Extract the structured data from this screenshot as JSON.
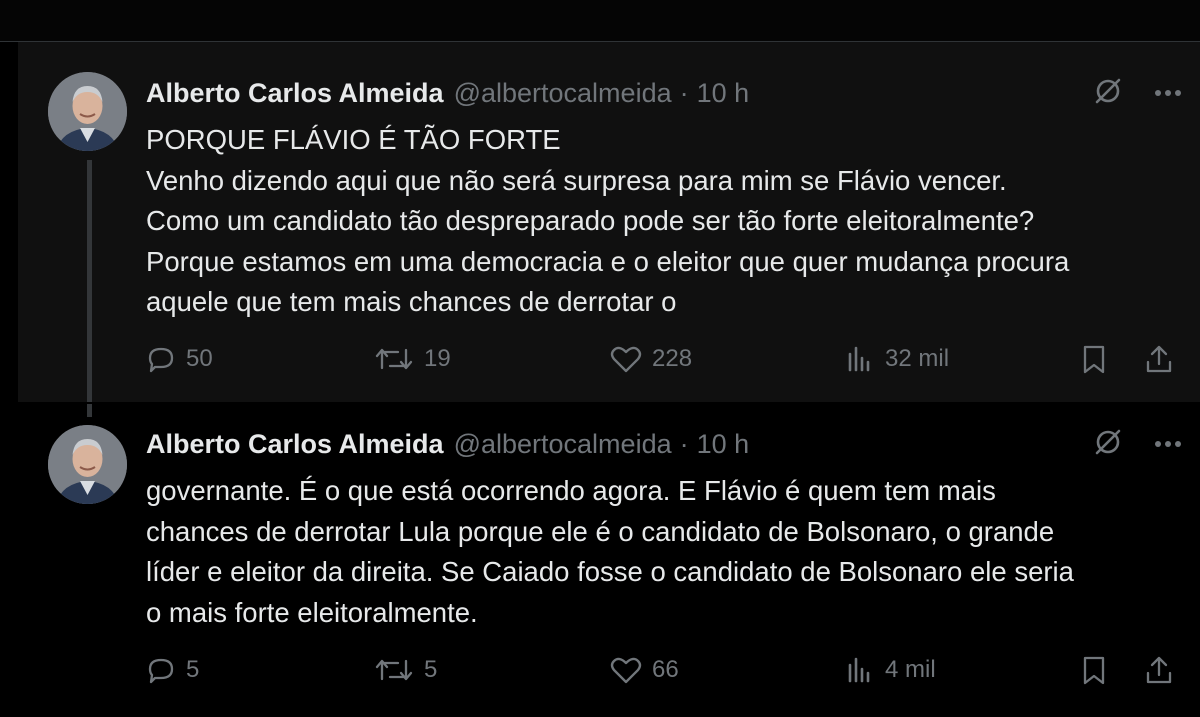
{
  "tweets": [
    {
      "author": {
        "name": "Alberto Carlos Almeida",
        "handle": "@albertocalmeida",
        "separator": "·",
        "time": "10 h"
      },
      "text": "PORQUE FLÁVIO É TÃO FORTE\nVenho dizendo aqui que não será surpresa para mim se Flávio vencer.\nComo um candidato tão despreparado pode ser tão forte eleitoralmente?\nPorque estamos em uma democracia e o eleitor que quer mudança procura\naquele que tem mais chances de derrotar o",
      "stats": {
        "replies": "50",
        "reposts": "19",
        "likes": "228",
        "views": "32 mil"
      }
    },
    {
      "author": {
        "name": "Alberto Carlos Almeida",
        "handle": "@albertocalmeida",
        "separator": "·",
        "time": "10 h"
      },
      "text": "governante. É o que está ocorrendo agora. E Flávio é quem tem mais\nchances de derrotar Lula porque ele é o candidato de Bolsonaro, o grande\nlíder e eleitor da direita. Se Caiado fosse o candidato de Bolsonaro ele seria\no mais forte eleitoralmente.",
      "stats": {
        "replies": "5",
        "reposts": "5",
        "likes": "66",
        "views": "4 mil"
      }
    }
  ],
  "icons": {
    "grok": "grok-icon",
    "more": "more-icon",
    "reply": "reply-icon",
    "repost": "repost-icon",
    "like": "like-icon",
    "views": "views-icon",
    "bookmark": "bookmark-icon",
    "share": "share-icon"
  },
  "colors": {
    "background": "#000000",
    "text": "#e7e9ea",
    "muted": "#71767b",
    "divider": "#2f3336"
  }
}
